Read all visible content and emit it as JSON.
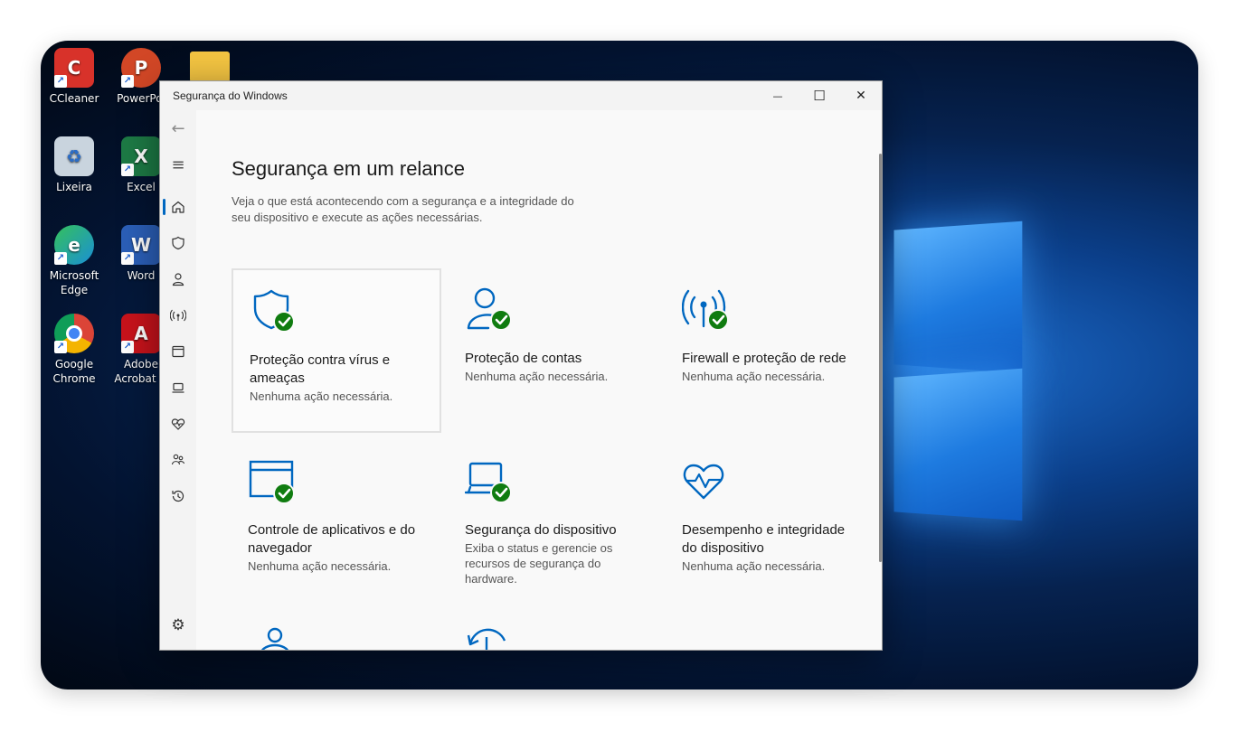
{
  "desktop": {
    "icons": [
      {
        "label": "CCleaner",
        "glyph": "C",
        "color": "#d8322a"
      },
      {
        "label": "PowerPoi",
        "glyph": "P",
        "color": "#d24726"
      },
      {
        "label": "Lixeira",
        "glyph": "♻",
        "color": "#6c7b8a"
      },
      {
        "label": "Excel",
        "glyph": "X",
        "color": "#1d7a45"
      },
      {
        "label": "Microsoft",
        "label2": "Edge",
        "glyph": "e",
        "color": "#1a8fd6"
      },
      {
        "label": "Word",
        "glyph": "W",
        "color": "#2b5fb8"
      },
      {
        "label": "Google",
        "label2": "Chrome",
        "glyph": "●",
        "color": "#e8a317"
      },
      {
        "label": "Adobe",
        "label2": "Acrobat D",
        "glyph": "A",
        "color": "#c8131b"
      }
    ]
  },
  "window": {
    "title": "Segurança do Windows",
    "controls": {
      "minimize": "—",
      "maximize": "☐",
      "close": "✕"
    }
  },
  "nav": {
    "back": "←",
    "menu": "≡",
    "settings": "⚙"
  },
  "page": {
    "title": "Segurança em um relance",
    "description": "Veja o que está acontecendo com a segurança e a integridade do seu dispositivo e execute as ações necessárias."
  },
  "tiles": [
    {
      "name": "Proteção contra vírus e ameaças",
      "status": "Nenhuma ação necessária.",
      "icon": "shield-check"
    },
    {
      "name": "Proteção de contas",
      "status": "Nenhuma ação necessária.",
      "icon": "person-check"
    },
    {
      "name": "Firewall e proteção de rede",
      "status": "Nenhuma ação necessária.",
      "icon": "antenna-check"
    },
    {
      "name": "Controle de aplicativos e do navegador",
      "status": "Nenhuma ação necessária.",
      "icon": "browser-check"
    },
    {
      "name": "Segurança do dispositivo",
      "status": "Exiba o status e gerencie os recursos de segurança do hardware.",
      "icon": "laptop-check"
    },
    {
      "name": "Desempenho e integridade do dispositivo",
      "status": "Nenhuma ação necessária.",
      "icon": "heart-pulse"
    }
  ],
  "colors": {
    "accent": "#0067c0",
    "check": "#107c10"
  }
}
